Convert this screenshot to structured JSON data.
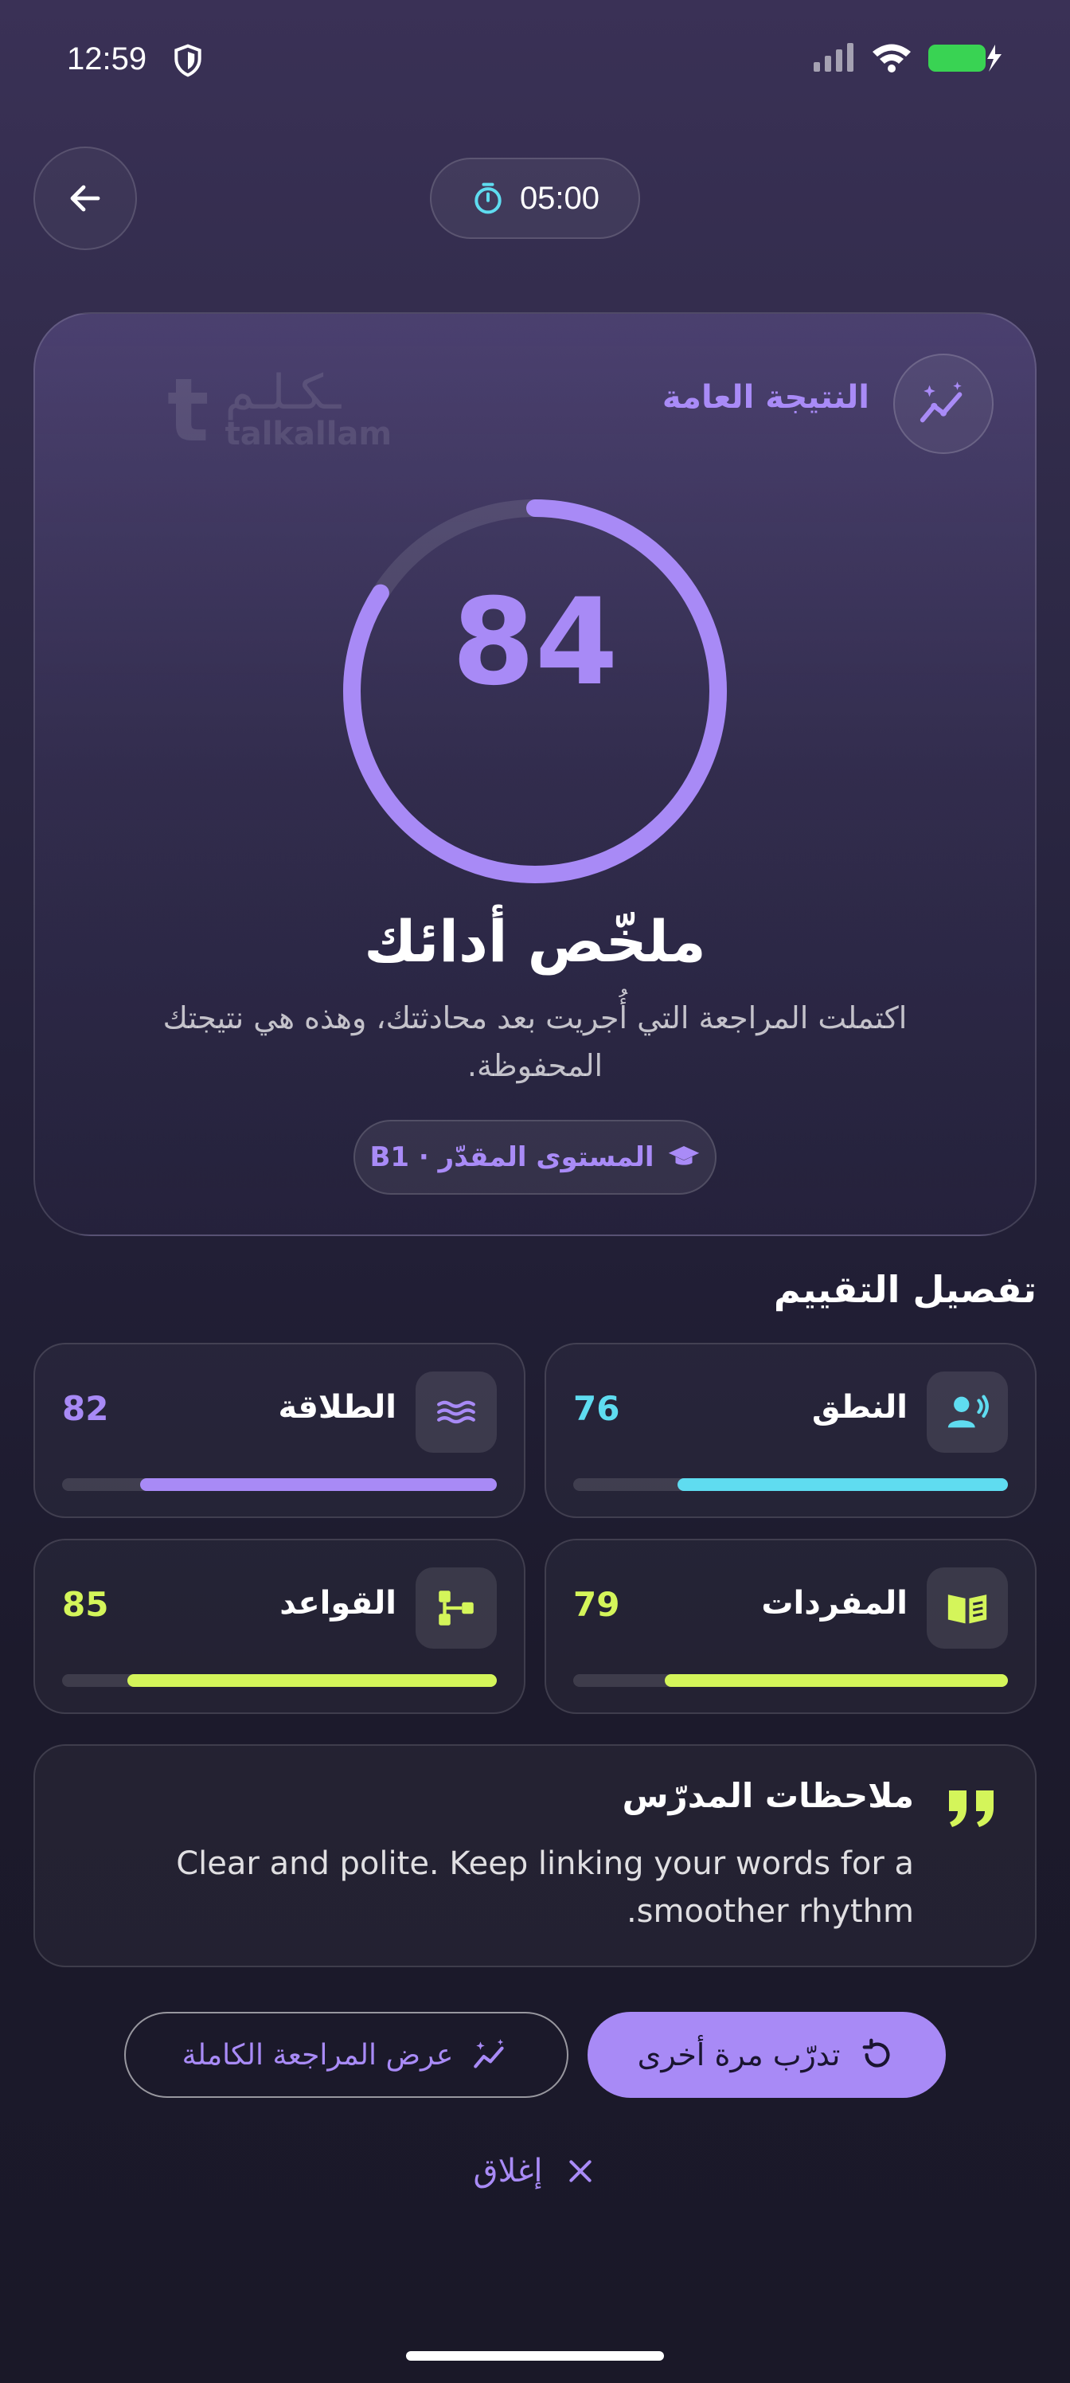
{
  "status_bar": {
    "time": "12:59"
  },
  "header": {
    "timer": "05:00"
  },
  "score_card": {
    "overall_label": "النتيجة العامة",
    "score": "84",
    "score_value": 84,
    "title": "ملخّص أدائك",
    "description": "اكتملت المراجعة التي أُجريت بعد محادثتك، وهذه هي نتيجتك المحفوظة.",
    "level": "المستوى المقدّر · B1",
    "logo_ar": "ـكـلـم",
    "logo_en": "talkallam"
  },
  "breakdown": {
    "title": "تفصيل التقييم",
    "metrics": [
      {
        "label": "النطق",
        "value": "76",
        "percent": 76,
        "color": "#5fdcf0",
        "icon": "pronunciation-icon"
      },
      {
        "label": "الطلاقة",
        "value": "82",
        "percent": 82,
        "color": "#a88af6",
        "icon": "fluency-icon"
      },
      {
        "label": "المفردات",
        "value": "79",
        "percent": 79,
        "color": "#d4f55a",
        "icon": "vocabulary-icon"
      },
      {
        "label": "القواعد",
        "value": "85",
        "percent": 85,
        "color": "#d4f55a",
        "icon": "grammar-icon"
      }
    ]
  },
  "teacher_notes": {
    "title": "ملاحظات المدرّس",
    "body": "Clear and polite. Keep linking your words for a smoother rhythm."
  },
  "actions": {
    "retry_label": "تدرّب مرة أخرى",
    "full_review_label": "عرض المراجعة الكاملة",
    "close_label": "إغلاق"
  },
  "colors": {
    "accent": "#a88af6",
    "cyan": "#5fdcf0",
    "lime": "#d4f55a"
  }
}
